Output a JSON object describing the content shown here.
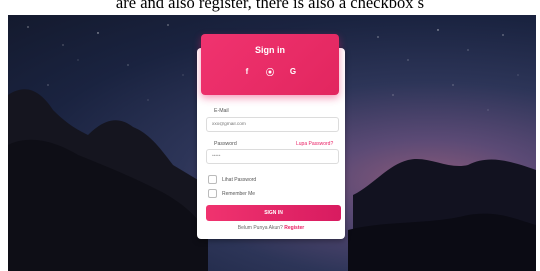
{
  "caption": "are and also register, there is also a checkbox s",
  "card": {
    "title": "Sign in",
    "social": [
      {
        "icon": "facebook-icon",
        "glyph": "f"
      },
      {
        "icon": "github-icon",
        "glyph": "⦿"
      },
      {
        "icon": "google-icon",
        "glyph": "G"
      }
    ],
    "email_label": "E-Mail",
    "email_placeholder": "xxx@gmail.com",
    "password_label": "Password",
    "forgot_password": "Lupa Password?",
    "password_value": "•••••",
    "show_password_label": "Lihat Password",
    "remember_me_label": "Remember Me",
    "signin_button": "SIGN IN",
    "register_prompt": "Belum Punya Akun?",
    "register_link": "Register"
  },
  "colors": {
    "accent": "#e91e63",
    "accent_dark": "#d81b60"
  }
}
